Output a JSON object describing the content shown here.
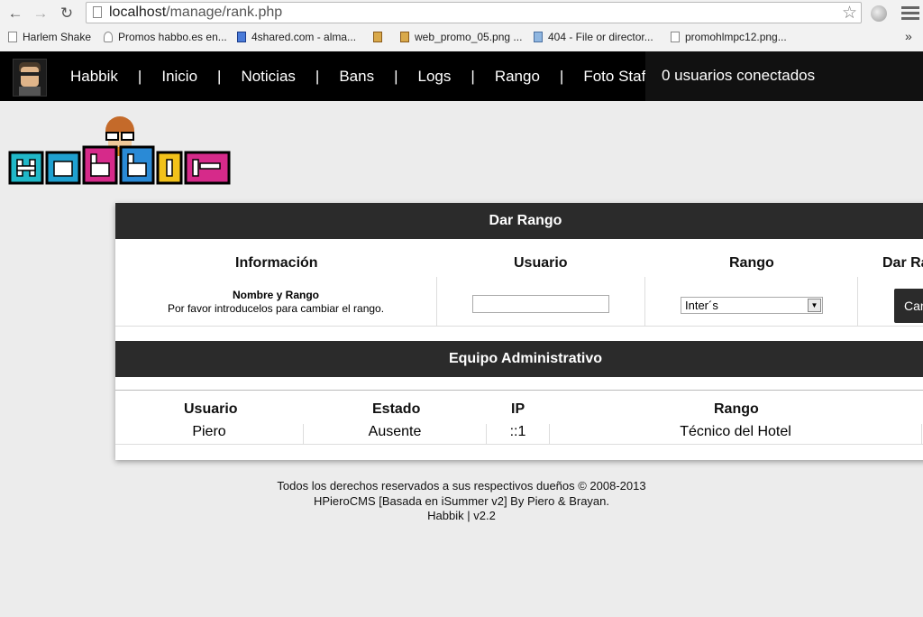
{
  "browser": {
    "url_host": "localhost",
    "url_path": "/manage/rank.php",
    "bookmarks": [
      "Harlem Shake",
      "Promos habbo.es en...",
      "4shared.com - alma...",
      "",
      "web_promo_05.png ...",
      "404 - File or director...",
      "promohlmpc12.png..."
    ],
    "more": "»"
  },
  "nav": {
    "items": [
      "Habbik",
      "Inicio",
      "Noticias",
      "Bans",
      "Logs",
      "Rango",
      "Foto Staff's"
    ],
    "separator": "|",
    "online": "0 usuarios conectados"
  },
  "rank_panel": {
    "title": "Dar Rango",
    "col_info": "Información",
    "col_user": "Usuario",
    "col_rank": "Rango",
    "col_give": "Dar Ra",
    "info_title": "Nombre y Rango",
    "info_text": "Por favor introducelos para cambiar el rango.",
    "user_value": "",
    "rank_selected": "Inter´s",
    "button": "Car"
  },
  "staff_panel": {
    "title": "Equipo Administrativo",
    "headers": [
      "Usuario",
      "Estado",
      "IP",
      "Rango"
    ],
    "rows": [
      [
        "Piero",
        "Ausente",
        "::1",
        "Técnico del Hotel"
      ]
    ]
  },
  "footer": {
    "line1": "Todos los derechos reservados a sus respectivos dueños © 2008-2013",
    "line2": "HPieroCMS [Basada en iSummer v2] By Piero & Brayan.",
    "line3": "Habbik | v2.2"
  }
}
